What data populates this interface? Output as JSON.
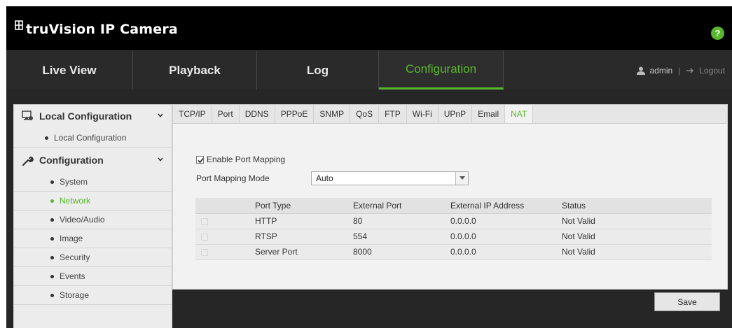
{
  "header": {
    "brand": "truVision IP Camera",
    "help_label": "?"
  },
  "nav": {
    "items": [
      {
        "label": "Live View"
      },
      {
        "label": "Playback"
      },
      {
        "label": "Log"
      },
      {
        "label": "Configuration",
        "active": true
      }
    ],
    "user": "admin",
    "separator": "|",
    "logout": "Logout"
  },
  "sidebar": {
    "local_header": "Local Configuration",
    "local_items": [
      {
        "label": "Local Configuration"
      }
    ],
    "config_header": "Configuration",
    "config_items": [
      {
        "label": "System"
      },
      {
        "label": "Network",
        "active": true
      },
      {
        "label": "Video/Audio"
      },
      {
        "label": "Image"
      },
      {
        "label": "Security"
      },
      {
        "label": "Events"
      },
      {
        "label": "Storage"
      }
    ]
  },
  "tabs": [
    {
      "label": "TCP/IP"
    },
    {
      "label": "Port"
    },
    {
      "label": "DDNS"
    },
    {
      "label": "PPPoE"
    },
    {
      "label": "SNMP"
    },
    {
      "label": "QoS"
    },
    {
      "label": "FTP"
    },
    {
      "label": "Wi-Fi"
    },
    {
      "label": "UPnP"
    },
    {
      "label": "Email"
    },
    {
      "label": "NAT",
      "active": true
    }
  ],
  "nat": {
    "enable_label": "Enable Port Mapping",
    "enable_checked": true,
    "mode_label": "Port Mapping Mode",
    "mode_value": "Auto",
    "table": {
      "columns": [
        "",
        "Port Type",
        "External Port",
        "External IP Address",
        "Status"
      ],
      "rows": [
        {
          "port_type": "HTTP",
          "external_port": "80",
          "external_ip": "0.0.0.0",
          "status": "Not Valid"
        },
        {
          "port_type": "RTSP",
          "external_port": "554",
          "external_ip": "0.0.0.0",
          "status": "Not Valid"
        },
        {
          "port_type": "Server Port",
          "external_port": "8000",
          "external_ip": "0.0.0.0",
          "status": "Not Valid"
        }
      ]
    }
  },
  "actions": {
    "save_label": "Save"
  },
  "colors": {
    "accent": "#58b82d",
    "header_bg": "#000000",
    "nav_bg": "#2a2a2a",
    "panel_bg": "#f2f2f2"
  }
}
